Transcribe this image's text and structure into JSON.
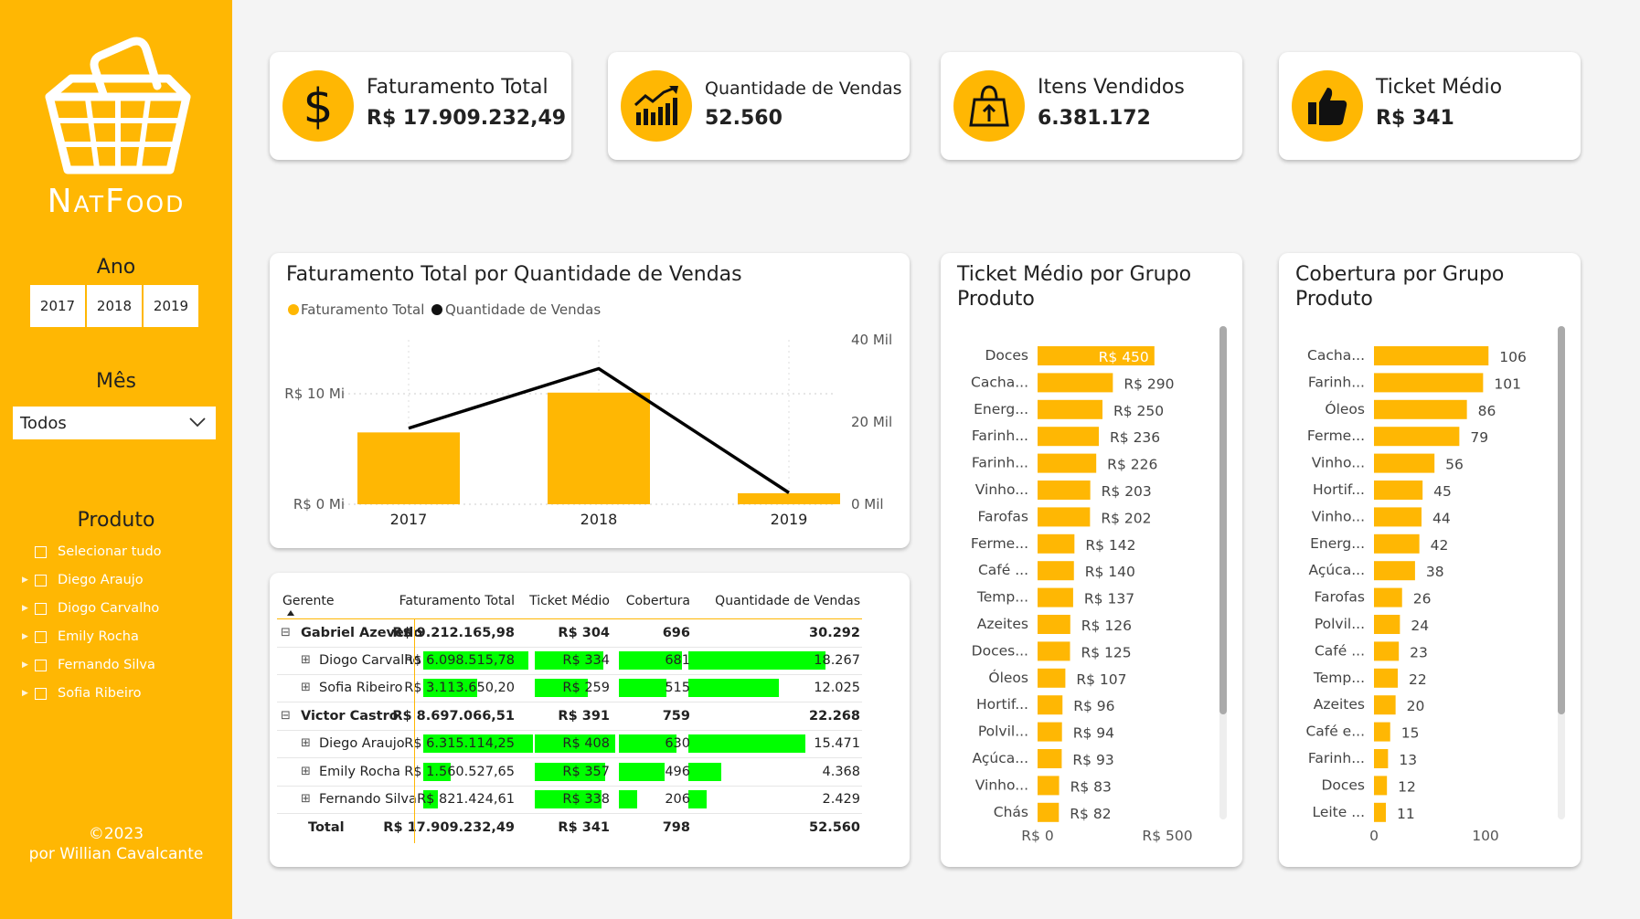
{
  "brand": {
    "name": "NatFood",
    "accent": "#ffb703"
  },
  "filters": {
    "year_title": "Ano",
    "years": [
      "2017",
      "2018",
      "2019"
    ],
    "month_title": "Mês",
    "month_value": "Todos",
    "product_title": "Produto",
    "products": [
      "Selecionar tudo",
      "Diego Araujo",
      "Diogo Carvalho",
      "Emily Rocha",
      "Fernando Silva",
      "Sofia Ribeiro"
    ]
  },
  "footer": {
    "line1": "©2023",
    "line2": "por Willian Cavalcante"
  },
  "kpis": [
    {
      "label": "Faturamento Total",
      "value": "R$ 17.909.232,49",
      "icon": "dollar-icon"
    },
    {
      "label": "Quantidade de Vendas",
      "value": "52.560",
      "icon": "growth-chart-icon"
    },
    {
      "label": "Itens Vendidos",
      "value": "6.381.172",
      "icon": "shopping-bag-icon"
    },
    {
      "label": "Ticket Médio",
      "value": "R$ 341",
      "icon": "thumbs-up-icon"
    }
  ],
  "combo_chart": {
    "title": "Faturamento Total por Quantidade de Vendas",
    "legend": [
      "Faturamento Total",
      "Quantidade de Vendas"
    ],
    "left_ticks": [
      "R$ 0 Mi",
      "R$ 10 Mi"
    ],
    "right_ticks": [
      "0 Mil",
      "20 Mil",
      "40 Mil"
    ],
    "bar_color": "#ffb703",
    "line_color": "#000000"
  },
  "ticket_chart": {
    "title_line1": "Ticket Médio por Grupo",
    "title_line2": "Produto",
    "axis_ticks": [
      "R$ 0",
      "R$ 500"
    ]
  },
  "cobertura_chart": {
    "title_line1": "Cobertura por Grupo",
    "title_line2": "Produto",
    "axis_ticks": [
      "0",
      "100"
    ]
  },
  "matrix": {
    "headers": [
      "Gerente",
      "Faturamento Total",
      "Ticket Médio",
      "Cobertura",
      "Quantidade de Vendas"
    ],
    "rows": [
      {
        "level": 0,
        "name": "Gabriel Azevedo",
        "fat": "R$ 9.212.165,98",
        "tm": "R$ 304",
        "cob": "696",
        "qv": "30.292"
      },
      {
        "level": 1,
        "name": "Diogo Carvalho",
        "fat": "R$ 6.098.515,78",
        "tm": "R$ 334",
        "cob": "681",
        "qv": "18.267",
        "bars": [
          0.96,
          0.85,
          0.98,
          1.0
        ]
      },
      {
        "level": 1,
        "name": "Sofia Ribeiro",
        "fat": "R$ 3.113.650,20",
        "tm": "R$ 259",
        "cob": "515",
        "qv": "12.025",
        "bars": [
          0.49,
          0.66,
          0.74,
          0.66
        ]
      },
      {
        "level": 0,
        "name": "Victor Castro",
        "fat": "R$ 8.697.066,51",
        "tm": "R$ 391",
        "cob": "759",
        "qv": "22.268"
      },
      {
        "level": 1,
        "name": "Diego Araujo",
        "fat": "R$ 6.315.114,25",
        "tm": "R$ 408",
        "cob": "630",
        "qv": "15.471",
        "bars": [
          1.0,
          1.0,
          0.9,
          0.85
        ]
      },
      {
        "level": 1,
        "name": "Emily Rocha",
        "fat": "R$ 1.560.527,65",
        "tm": "R$ 357",
        "cob": "496",
        "qv": "4.368",
        "bars": [
          0.25,
          0.88,
          0.71,
          0.24
        ]
      },
      {
        "level": 1,
        "name": "Fernando Silva",
        "fat": "R$ 821.424,61",
        "tm": "R$ 338",
        "cob": "206",
        "qv": "2.429",
        "bars": [
          0.13,
          0.83,
          0.29,
          0.13
        ]
      }
    ],
    "total": {
      "name": "Total",
      "fat": "R$ 17.909.232,49",
      "tm": "R$ 341",
      "cob": "798",
      "qv": "52.560"
    }
  },
  "chart_data": [
    {
      "type": "bar",
      "title": "Faturamento Total por Quantidade de Vendas",
      "categories": [
        "2017",
        "2018",
        "2019"
      ],
      "series": [
        {
          "name": "Faturamento Total",
          "type": "bar",
          "values": [
            6.5,
            10.1,
            1.0
          ],
          "unit": "R$ Mi"
        },
        {
          "name": "Quantidade de Vendas",
          "type": "line",
          "values": [
            18.5,
            33.0,
            2.8
          ],
          "unit": "Mil"
        }
      ],
      "ylim_left": [
        0,
        15
      ],
      "ylim_right": [
        0,
        40
      ]
    },
    {
      "type": "bar",
      "orientation": "horizontal",
      "title": "Ticket Médio por Grupo Produto",
      "categories": [
        "Doces",
        "Cacha...",
        "Energ...",
        "Farinh...",
        "Farinh...",
        "Vinho...",
        "Farofas",
        "Ferme...",
        "Café ...",
        "Temp...",
        "Azeites",
        "Doces...",
        "Óleos",
        "Hortif...",
        "Polvil...",
        "Açúca...",
        "Vinho...",
        "Chás"
      ],
      "values": [
        450,
        290,
        250,
        236,
        226,
        203,
        202,
        142,
        140,
        137,
        126,
        125,
        107,
        96,
        94,
        93,
        83,
        82
      ],
      "labels": [
        "R$ 450",
        "R$ 290",
        "R$ 250",
        "R$ 236",
        "R$ 226",
        "R$ 203",
        "R$ 202",
        "R$ 142",
        "R$ 140",
        "R$ 137",
        "R$ 126",
        "R$ 125",
        "R$ 107",
        "R$ 96",
        "R$ 94",
        "R$ 93",
        "R$ 83",
        "R$ 82"
      ],
      "xlim": [
        0,
        500
      ]
    },
    {
      "type": "bar",
      "orientation": "horizontal",
      "title": "Cobertura por Grupo Produto",
      "categories": [
        "Cacha...",
        "Farinh...",
        "Óleos",
        "Ferme...",
        "Vinho...",
        "Hortif...",
        "Vinho...",
        "Energ...",
        "Açúca...",
        "Farofas",
        "Polvil...",
        "Café ...",
        "Temp...",
        "Azeites",
        "Café e...",
        "Farinh...",
        "Doces",
        "Leite ..."
      ],
      "values": [
        106,
        101,
        86,
        79,
        56,
        45,
        44,
        42,
        38,
        26,
        24,
        23,
        22,
        20,
        15,
        13,
        12,
        11
      ],
      "xlim": [
        0,
        110
      ]
    }
  ]
}
